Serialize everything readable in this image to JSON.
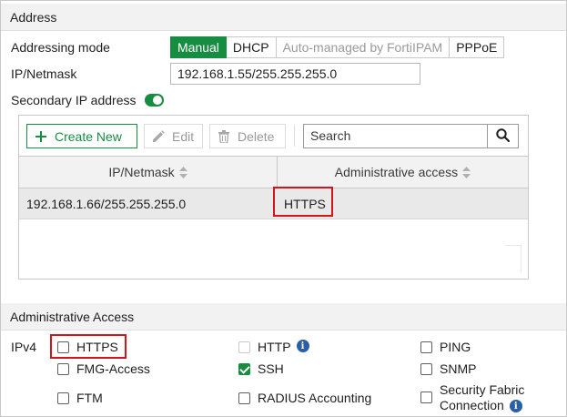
{
  "address_section": {
    "title": "Address",
    "addressing_mode_label": "Addressing mode",
    "modes": [
      {
        "label": "Manual",
        "state": "active"
      },
      {
        "label": "DHCP",
        "state": "normal"
      },
      {
        "label": "Auto-managed by FortiIPAM",
        "state": "disabled"
      },
      {
        "label": "PPPoE",
        "state": "normal"
      }
    ],
    "ip_netmask_label": "IP/Netmask",
    "ip_netmask_value": "192.168.1.55/255.255.255.0",
    "secondary_ip_label": "Secondary IP address",
    "secondary_ip_enabled": true
  },
  "toolbar": {
    "create_label": "Create New",
    "edit_label": "Edit",
    "delete_label": "Delete",
    "search_placeholder": "Search"
  },
  "table": {
    "columns": [
      "IP/Netmask",
      "Administrative access"
    ],
    "rows": [
      {
        "ip_netmask": "192.168.1.66/255.255.255.0",
        "access": "HTTPS"
      }
    ]
  },
  "admin_section": {
    "title": "Administrative Access",
    "ipv4_label": "IPv4",
    "options": [
      {
        "label": "HTTPS",
        "checked": false,
        "disabled": false,
        "info": false
      },
      {
        "label": "HTTP",
        "checked": false,
        "disabled": true,
        "info": true
      },
      {
        "label": "PING",
        "checked": false,
        "disabled": false,
        "info": false
      },
      {
        "label": "FMG-Access",
        "checked": false,
        "disabled": false,
        "info": false
      },
      {
        "label": "SSH",
        "checked": true,
        "disabled": false,
        "info": false
      },
      {
        "label": "SNMP",
        "checked": false,
        "disabled": false,
        "info": false
      },
      {
        "label": "FTM",
        "checked": false,
        "disabled": false,
        "info": false
      },
      {
        "label": "RADIUS Accounting",
        "checked": false,
        "disabled": false,
        "info": false
      },
      {
        "label_line1": "Security Fabric",
        "label_line2": "Connection",
        "checked": false,
        "disabled": false,
        "info": true
      }
    ]
  },
  "colors": {
    "accent": "#168d40",
    "highlight": "#d4141c",
    "info": "#2a5fa8"
  },
  "icons": {
    "create": "plus-icon",
    "edit": "pencil-icon",
    "delete": "trash-icon",
    "search": "search-icon",
    "sort": "sort-icon",
    "info": "info-icon"
  }
}
